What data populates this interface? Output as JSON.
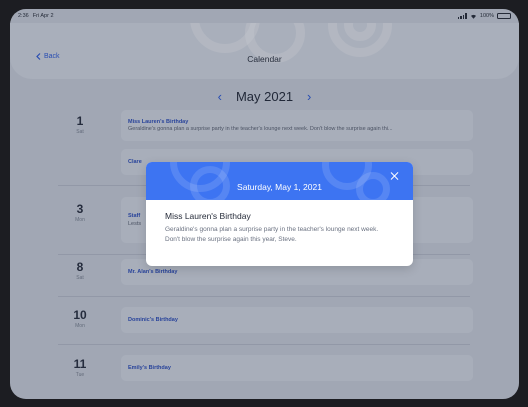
{
  "status_bar": {
    "time": "2:36",
    "date": "Fri Apr 2",
    "battery": "100%"
  },
  "header": {
    "back_label": "Back",
    "title": "Calendar"
  },
  "month_nav": {
    "prev_icon": "chevron-left-icon",
    "label": "May 2021",
    "next_icon": "chevron-right-icon"
  },
  "days": [
    {
      "num": "1",
      "weekday": "Sat",
      "events": [
        {
          "title": "Miss Lauren's Birthday",
          "body": "Geraldine's gonna plan a surprise party in the teacher's lounge next week. Don't blow the surprise again thi..."
        },
        {
          "title": "Clare",
          "body": ""
        }
      ]
    },
    {
      "num": "3",
      "weekday": "Mon",
      "events": [
        {
          "title": "Staff",
          "body": "Lests"
        }
      ]
    },
    {
      "num": "8",
      "weekday": "Sat",
      "events": [
        {
          "title": "Mr. Alan's Birthday",
          "body": ""
        }
      ]
    },
    {
      "num": "10",
      "weekday": "Mon",
      "events": [
        {
          "title": "Dominic's Birthday",
          "body": ""
        }
      ]
    },
    {
      "num": "11",
      "weekday": "Tue",
      "events": [
        {
          "title": "Emily's Birthday",
          "body": ""
        }
      ]
    }
  ],
  "modal": {
    "date": "Saturday, May 1, 2021",
    "title": "Miss Lauren's Birthday",
    "description": "Geraldine's gonna plan a surprise party in the teacher's lounge next week. Don't blow the surprise again this year, Steve.",
    "close_icon": "close-icon"
  },
  "colors": {
    "accent": "#3d74f2",
    "link": "#2f5bd6",
    "background": "#c9cfd9"
  }
}
